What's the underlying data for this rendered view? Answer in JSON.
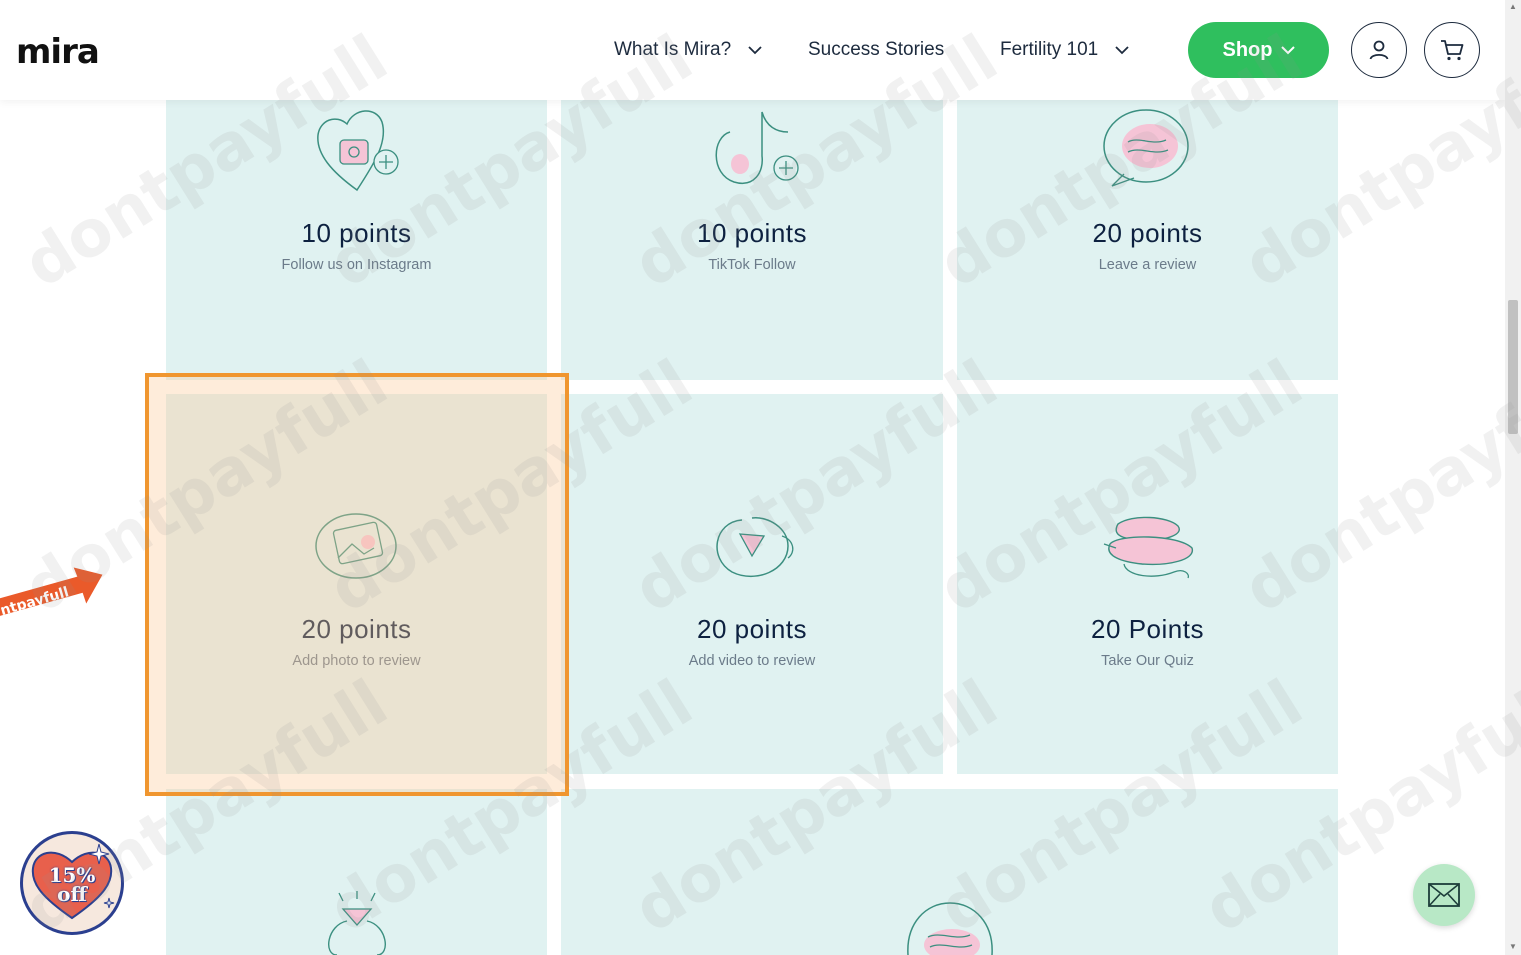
{
  "header": {
    "logo": "mira",
    "nav": [
      {
        "label": "What Is Mira?",
        "has_dropdown": true
      },
      {
        "label": "Success Stories",
        "has_dropdown": false
      },
      {
        "label": "Fertility 101",
        "has_dropdown": true
      }
    ],
    "shop_label": "Shop",
    "shop_color": "#2fbf5e",
    "icons": [
      "account-icon",
      "cart-icon"
    ]
  },
  "tiles": [
    {
      "points": "10 points",
      "desc": "Follow us on Instagram",
      "icon": "instagram-heart-icon"
    },
    {
      "points": "10 points",
      "desc": "TikTok Follow",
      "icon": "tiktok-icon"
    },
    {
      "points": "20 points",
      "desc": "Leave a review",
      "icon": "review-bubble-icon"
    },
    {
      "points": "20 points",
      "desc": "Add photo to review",
      "icon": "photo-icon"
    },
    {
      "points": "20 points",
      "desc": "Add video to review",
      "icon": "video-play-icon"
    },
    {
      "points": "20 Points",
      "desc": "Take Our Quiz",
      "icon": "quiz-bubbles-icon"
    },
    {
      "points": "",
      "desc": "",
      "icon": "ring-icon"
    },
    {
      "points": "",
      "desc": "",
      "icon": "review-bubble-icon"
    }
  ],
  "tile_color": "#e0f2f1",
  "highlight_color": "#f0962f",
  "watermark": "dontpayfull",
  "promo_arrow_label": "ntpayfull",
  "badge": {
    "line1": "15%",
    "line2": "off"
  },
  "contact": {
    "icon": "mail-icon"
  }
}
